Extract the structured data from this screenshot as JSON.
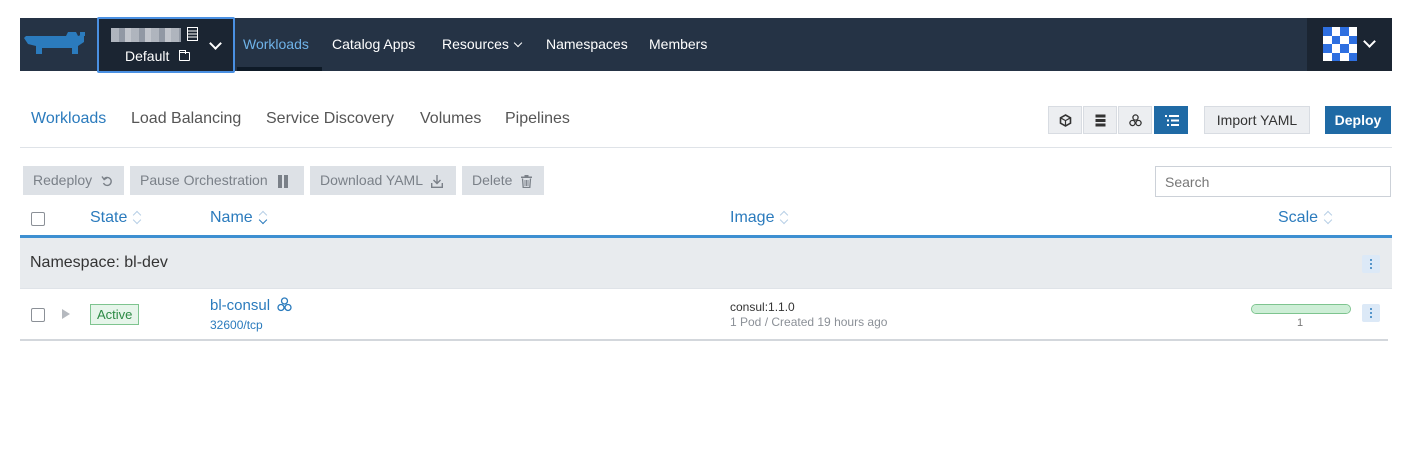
{
  "colors": {
    "navbar_bg": "#253345",
    "accent": "#2b7bbd",
    "deploy_bg": "#1f6aa5",
    "active_badge": "#2d8a45",
    "scale_bar": "#cdeed6"
  },
  "navbar": {
    "cluster": {
      "project_label": "Default"
    },
    "items": [
      {
        "label": "Workloads",
        "active": true
      },
      {
        "label": "Catalog Apps"
      },
      {
        "label": "Resources",
        "has_dropdown": true
      },
      {
        "label": "Namespaces"
      },
      {
        "label": "Members"
      }
    ]
  },
  "tabs": [
    {
      "label": "Workloads",
      "active": true
    },
    {
      "label": "Load Balancing"
    },
    {
      "label": "Service Discovery"
    },
    {
      "label": "Volumes"
    },
    {
      "label": "Pipelines"
    }
  ],
  "view_modes": [
    {
      "icon": "cube-icon"
    },
    {
      "icon": "server-stack-icon"
    },
    {
      "icon": "cluster-nodes-icon"
    },
    {
      "icon": "list-icon",
      "active": true
    }
  ],
  "toolbar": {
    "import_label": "Import YAML",
    "deploy_label": "Deploy"
  },
  "actions": {
    "redeploy": "Redeploy",
    "pause": "Pause Orchestration",
    "download": "Download YAML",
    "delete": "Delete"
  },
  "search": {
    "placeholder": "Search",
    "value": ""
  },
  "table": {
    "headers": {
      "state": "State",
      "name": "Name",
      "image": "Image",
      "scale": "Scale"
    },
    "group": {
      "label": "Namespace: bl-dev"
    },
    "rows": [
      {
        "state": "Active",
        "name": "bl-consul",
        "port": "32600/tcp",
        "image": "consul:1.1.0",
        "image_meta": "1 Pod / Created 19 hours ago",
        "scale": "1",
        "scale_fraction": 1.0
      }
    ]
  }
}
